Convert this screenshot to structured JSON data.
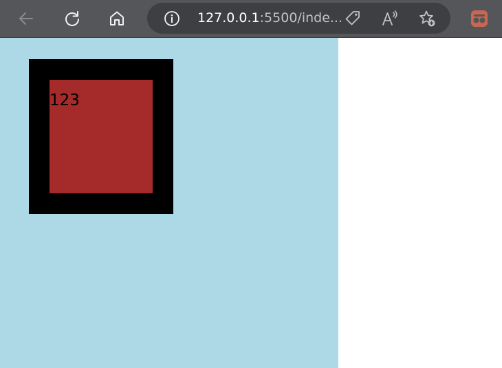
{
  "browser": {
    "url_host": "127.0.0.1",
    "url_rest": ":5500/inde..."
  },
  "icons": {
    "back": "back-arrow-icon",
    "refresh": "refresh-icon",
    "home": "home-icon",
    "info": "info-icon",
    "tag": "tag-icon",
    "read_aloud": "read-aloud-icon",
    "favorite": "add-favorite-icon",
    "extension": "extension-icon"
  },
  "page": {
    "box_text": "123"
  },
  "colors": {
    "toolbar": "#55565a",
    "address_bar": "#3e3f43",
    "panel": "#add8e6",
    "outer_box": "#000000",
    "inner_box": "#a52a2a",
    "extension_accent": "#c9674f"
  }
}
